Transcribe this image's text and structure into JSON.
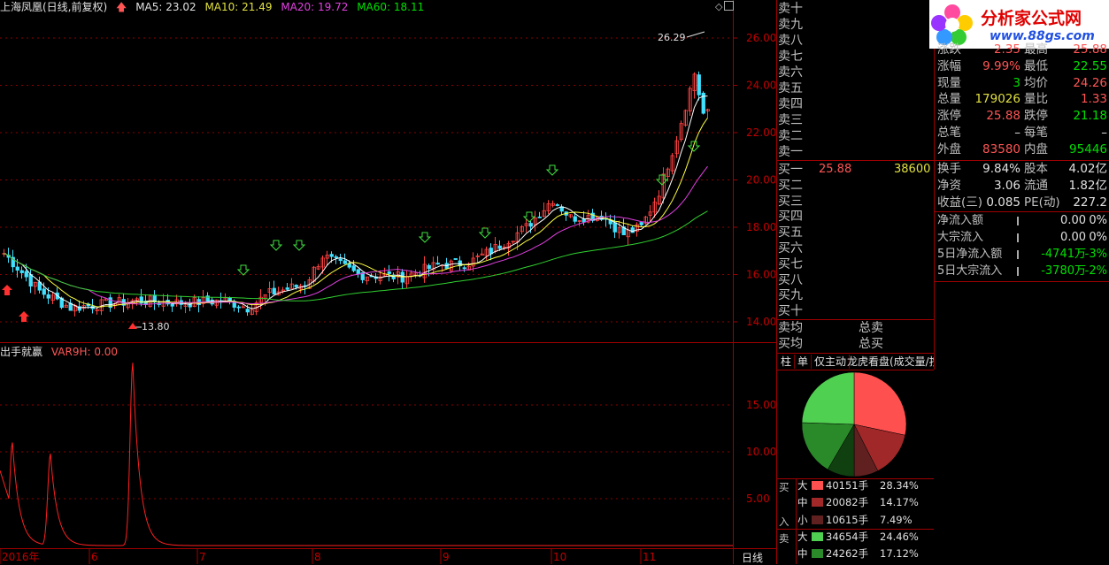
{
  "header": {
    "title": "上海凤凰(日线,前复权)",
    "ma5": "MA5: 23.02",
    "ma10": "MA10: 21.49",
    "ma20": "MA20: 19.72",
    "ma60": "MA60: 18.11"
  },
  "main_chart": {
    "high_label": "26.29",
    "low_label": "13.80",
    "y_ticks": [
      "26.00",
      "24.00",
      "22.00",
      "20.00",
      "18.00",
      "16.00",
      "14.00"
    ],
    "x_labels": [
      "2016年",
      "6",
      "7",
      "8",
      "9",
      "10",
      "11"
    ],
    "period_label": "日线"
  },
  "indicator": {
    "name": "出手就赢",
    "var_label": "VAR9H: 0.00",
    "y_ticks": [
      "15.00",
      "10.00",
      "5.00"
    ]
  },
  "order_book": {
    "sell_labels": [
      "卖十",
      "卖九",
      "卖八",
      "卖七",
      "卖六",
      "卖五",
      "卖四",
      "卖三",
      "卖二",
      "卖一"
    ],
    "buy_labels": [
      "买一",
      "买二",
      "买三",
      "买四",
      "买五",
      "买六",
      "买七",
      "买八",
      "买九",
      "买十"
    ],
    "buy1_price": "25.88",
    "buy1_volume": "38600",
    "sell_avg_label": "卖均",
    "buy_avg_label": "买均",
    "total_sell_label": "总卖",
    "total_buy_label": "总买"
  },
  "logo": {
    "title": "分析家公式网",
    "url": "www.88gs.com"
  },
  "stats": [
    {
      "k": "涨跌",
      "v": "2.35",
      "vc": "red",
      "k2": "最高",
      "v2": "25.88",
      "v2c": "red"
    },
    {
      "k": "涨幅",
      "v": "9.99%",
      "vc": "red",
      "k2": "最低",
      "v2": "22.55",
      "v2c": "green"
    },
    {
      "k": "现量",
      "v": "3",
      "vc": "green",
      "k2": "均价",
      "v2": "24.26",
      "v2c": "red"
    },
    {
      "k": "总量",
      "v": "179026",
      "vc": "yellow",
      "k2": "量比",
      "v2": "1.33",
      "v2c": "red"
    },
    {
      "k": "涨停",
      "v": "25.88",
      "vc": "red",
      "k2": "跌停",
      "v2": "21.18",
      "v2c": "green"
    },
    {
      "k": "总笔",
      "v": "–",
      "vc": "white",
      "k2": "每笔",
      "v2": "–",
      "v2c": "white"
    },
    {
      "k": "外盘",
      "v": "83580",
      "vc": "red",
      "k2": "内盘",
      "v2": "95446",
      "v2c": "green"
    }
  ],
  "stats2": [
    {
      "k": "换手",
      "v": "9.84%",
      "vc": "white",
      "k2": "股本",
      "v2": "4.02亿",
      "v2c": "white"
    },
    {
      "k": "净资",
      "v": "3.06",
      "vc": "white",
      "k2": "流通",
      "v2": "1.82亿",
      "v2c": "white"
    },
    {
      "k": "收益(三)",
      "v": "0.085",
      "vc": "white",
      "k2": "PE(动)",
      "v2": "227.2",
      "v2c": "white"
    }
  ],
  "flows": [
    {
      "k": "净流入额",
      "v": "0.00",
      "p": "0%",
      "c": "white"
    },
    {
      "k": "大宗流入",
      "v": "0.00",
      "p": "0%",
      "c": "white"
    },
    {
      "k": "5日净流入额",
      "v": "-4741万",
      "p": "-3%",
      "c": "green"
    },
    {
      "k": "5日大宗流入",
      "v": "-3780万",
      "p": "-2%",
      "c": "green"
    }
  ],
  "tabs": [
    "柱",
    "单",
    "仅主动",
    "龙虎看盘(成交量/按"
  ],
  "pie": {
    "slices": [
      {
        "label": "买大",
        "pct": 28.34,
        "color": "#ff5050"
      },
      {
        "label": "买中",
        "pct": 14.17,
        "color": "#a02828"
      },
      {
        "label": "买小",
        "pct": 7.49,
        "color": "#602020"
      },
      {
        "label": "卖小",
        "pct": 8.46,
        "color": "#104010"
      },
      {
        "label": "卖中",
        "pct": 17.12,
        "color": "#2a8a2a"
      },
      {
        "label": "卖大",
        "pct": 24.46,
        "color": "#50d050"
      }
    ]
  },
  "breakdown": {
    "buy_side": "买",
    "in_side": "入",
    "sell_side": "卖",
    "rows": [
      {
        "size": "大",
        "qty": "40151手",
        "pct": "28.34%",
        "color": "#ff5050"
      },
      {
        "size": "中",
        "qty": "20082手",
        "pct": "14.17%",
        "color": "#a02828"
      },
      {
        "size": "小",
        "qty": "10615手",
        "pct": "7.49%",
        "color": "#602020"
      },
      {
        "size": "大",
        "qty": "34654手",
        "pct": "24.46%",
        "color": "#50d050"
      },
      {
        "size": "中",
        "qty": "24262手",
        "pct": "17.12%",
        "color": "#2a8a2a"
      }
    ]
  }
}
